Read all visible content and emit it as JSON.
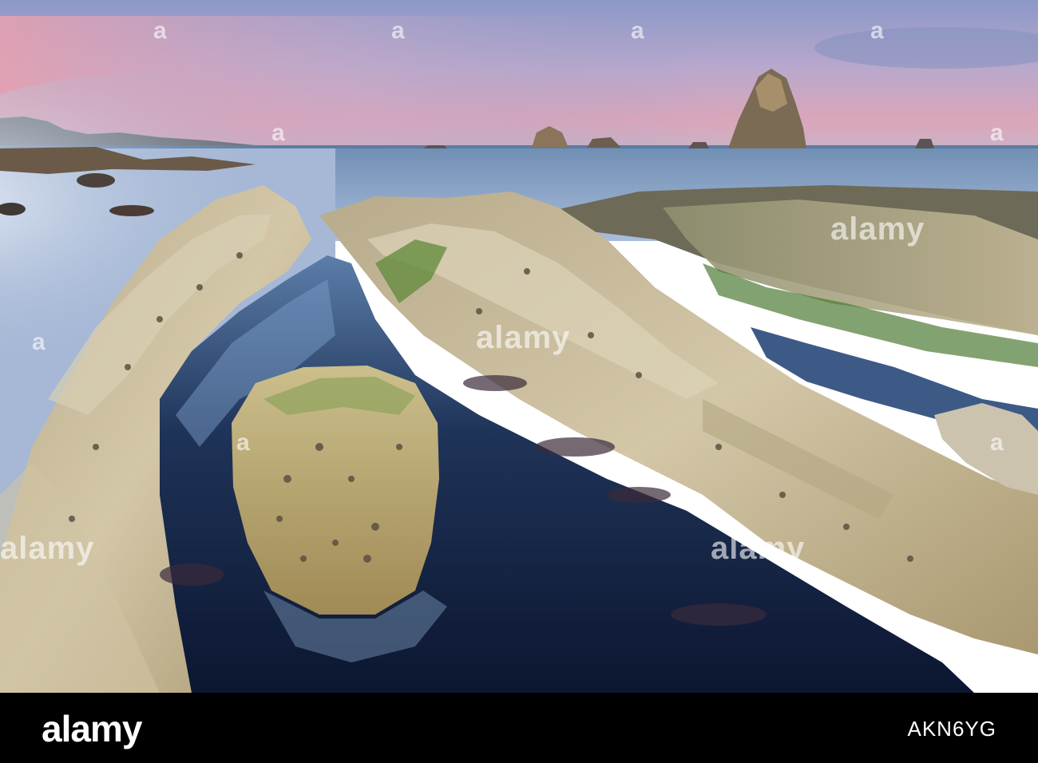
{
  "photo": {
    "subject": "",
    "colors": {
      "sky_top": "#8e9ac4",
      "sky_pink": "#e2a4b4",
      "sea": "#7fa0c2",
      "pool": "#14223d",
      "rock": "#c8b68f",
      "algae": "#5f8a3a"
    }
  },
  "watermark": {
    "text": "a",
    "logo_text": "alamy",
    "icon": "alamy-watermark-icon"
  },
  "footer": {
    "logo": "alamy",
    "stock_id": "AKN6YG"
  }
}
